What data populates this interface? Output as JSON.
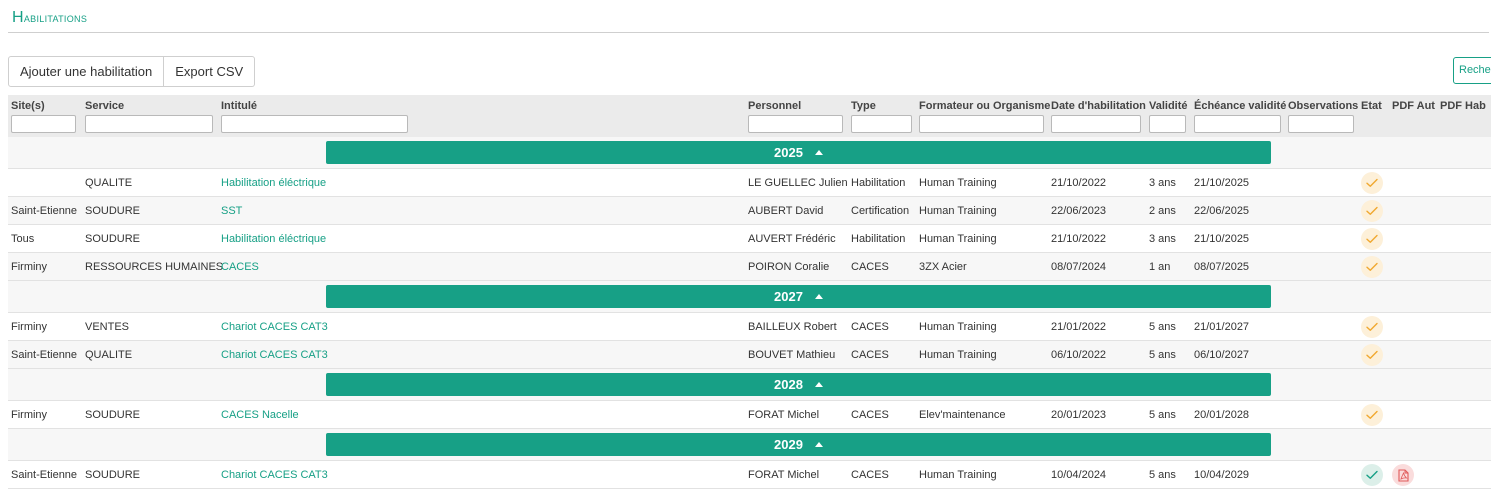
{
  "page": {
    "title_initial": "H",
    "title_rest": "abilitations"
  },
  "toolbar": {
    "add_label": "Ajouter une habilitation",
    "export_label": "Export CSV",
    "search_label": "Recherche"
  },
  "colors": {
    "accent": "#17a086",
    "warn_bg": "#fdf0d9",
    "warn_icon": "#f0a830",
    "ok_bg": "#dcefe9",
    "pdf_bg": "#fadcdc",
    "pdf_icon": "#e05a5a"
  },
  "columns": [
    {
      "key": "site",
      "label": "Site(s)"
    },
    {
      "key": "service",
      "label": "Service"
    },
    {
      "key": "intitule",
      "label": "Intitulé"
    },
    {
      "key": "personnel",
      "label": "Personnel"
    },
    {
      "key": "type",
      "label": "Type"
    },
    {
      "key": "formateur",
      "label": "Formateur ou Organisme"
    },
    {
      "key": "date",
      "label": "Date d'habilitation"
    },
    {
      "key": "validite",
      "label": "Validité"
    },
    {
      "key": "echeance",
      "label": "Échéance validité"
    },
    {
      "key": "observations",
      "label": "Observations"
    },
    {
      "key": "etat",
      "label": "Etat"
    },
    {
      "key": "pdf_aut",
      "label": "PDF Aut"
    },
    {
      "key": "pdf_hab",
      "label": "PDF Hab"
    }
  ],
  "groups": [
    {
      "year": "2025",
      "rows": [
        {
          "site": "",
          "service": "QUALITE",
          "intitule": "Habilitation éléctrique",
          "personnel": "LE GUELLEC Julien",
          "type": "Habilitation",
          "formateur": "Human Training",
          "date": "21/10/2022",
          "validite": "3 ans",
          "echeance": "21/10/2025",
          "etat": "warn",
          "pdf": false
        },
        {
          "site": "Saint-Etienne",
          "service": "SOUDURE",
          "intitule": "SST",
          "personnel": "AUBERT David",
          "type": "Certification",
          "formateur": "Human Training",
          "date": "22/06/2023",
          "validite": "2 ans",
          "echeance": "22/06/2025",
          "etat": "warn",
          "pdf": false
        },
        {
          "site": "Tous",
          "service": "SOUDURE",
          "intitule": "Habilitation éléctrique",
          "personnel": "AUVERT Frédéric",
          "type": "Habilitation",
          "formateur": "Human Training",
          "date": "21/10/2022",
          "validite": "3 ans",
          "echeance": "21/10/2025",
          "etat": "warn",
          "pdf": false
        },
        {
          "site": "Firminy",
          "service": "RESSOURCES HUMAINES",
          "intitule": "CACES",
          "personnel": "POIRON Coralie",
          "type": "CACES",
          "formateur": "3ZX Acier",
          "date": "08/07/2024",
          "validite": "1 an",
          "echeance": "08/07/2025",
          "etat": "warn",
          "pdf": false
        }
      ]
    },
    {
      "year": "2027",
      "rows": [
        {
          "site": "Firminy",
          "service": "VENTES",
          "intitule": "Chariot CACES CAT3",
          "personnel": "BAILLEUX Robert",
          "type": "CACES",
          "formateur": "Human Training",
          "date": "21/01/2022",
          "validite": "5 ans",
          "echeance": "21/01/2027",
          "etat": "warn",
          "pdf": false
        },
        {
          "site": "Saint-Etienne",
          "service": "QUALITE",
          "intitule": "Chariot CACES CAT3",
          "personnel": "BOUVET Mathieu",
          "type": "CACES",
          "formateur": "Human Training",
          "date": "06/10/2022",
          "validite": "5 ans",
          "echeance": "06/10/2027",
          "etat": "warn",
          "pdf": false
        }
      ]
    },
    {
      "year": "2028",
      "rows": [
        {
          "site": "Firminy",
          "service": "SOUDURE",
          "intitule": "CACES Nacelle",
          "personnel": "FORAT Michel",
          "type": "CACES",
          "formateur": "Elev'maintenance",
          "date": "20/01/2023",
          "validite": "5 ans",
          "echeance": "20/01/2028",
          "etat": "warn",
          "pdf": false
        }
      ]
    },
    {
      "year": "2029",
      "rows": [
        {
          "site": "Saint-Etienne",
          "service": "SOUDURE",
          "intitule": "Chariot CACES CAT3",
          "personnel": "FORAT Michel",
          "type": "CACES",
          "formateur": "Human Training",
          "date": "10/04/2024",
          "validite": "5 ans",
          "echeance": "10/04/2029",
          "etat": "ok",
          "pdf": true
        }
      ]
    }
  ]
}
